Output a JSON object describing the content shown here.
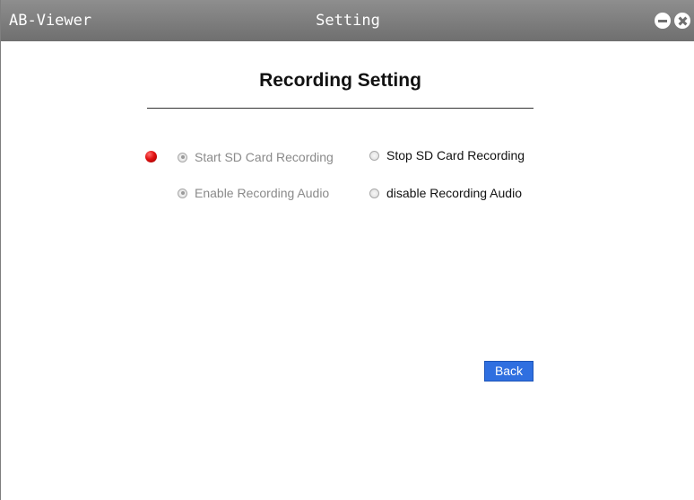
{
  "window": {
    "app_name": "AB-Viewer",
    "title": "Setting"
  },
  "icons": {
    "minimize": "minimize-icon",
    "close": "close-icon",
    "status": "recording-status-icon"
  },
  "colors": {
    "titlebar": "#7f7f7f",
    "status_dot": "#e01010",
    "back_button": "#2f6fe0"
  },
  "page": {
    "heading": "Recording Setting"
  },
  "recording": {
    "start_label": "Start SD Card Recording",
    "stop_label": "Stop SD Card Recording",
    "start_disabled": true,
    "selected": "start"
  },
  "audio": {
    "enable_label": "Enable Recording Audio",
    "disable_label": "disable Recording Audio",
    "enable_disabled": true,
    "selected": "enable"
  },
  "actions": {
    "back_label": "Back"
  }
}
